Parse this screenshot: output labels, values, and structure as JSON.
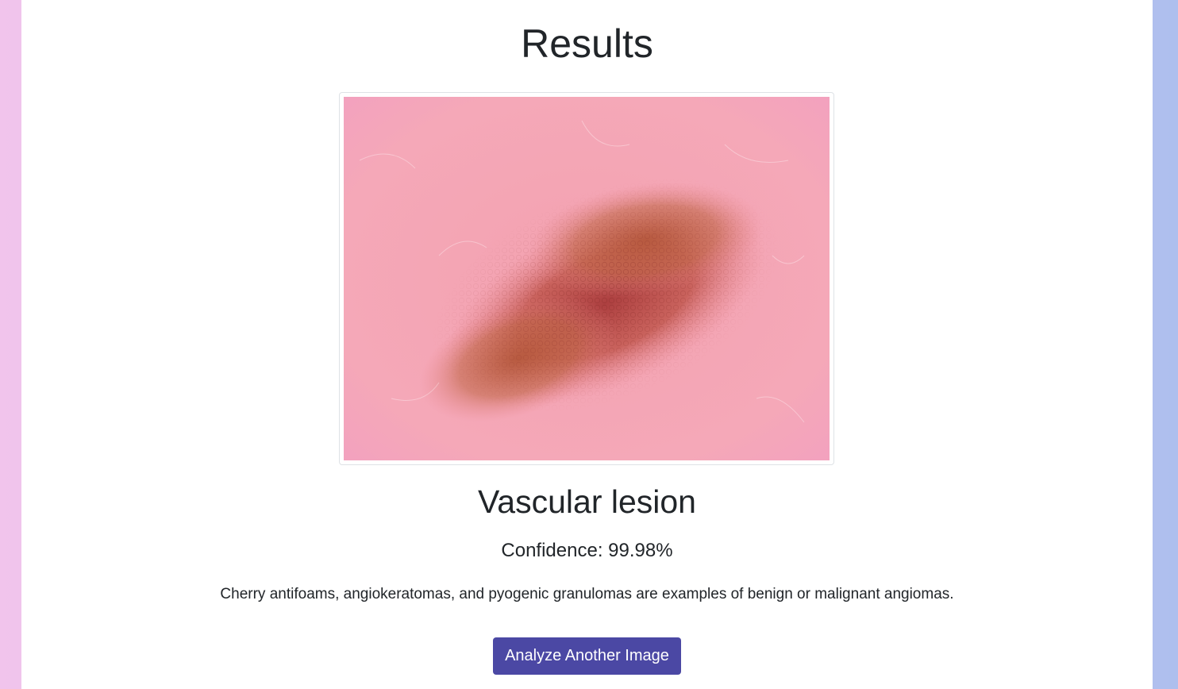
{
  "page": {
    "title": "Results"
  },
  "result": {
    "image_alt": "Uploaded skin lesion image",
    "diagnosis": "Vascular lesion",
    "confidence_label": "Confidence:",
    "confidence_value": "99.98%",
    "description": "Cherry antifoams, angiokeratomas, and pyogenic granulomas are examples of benign or malignant angiomas."
  },
  "actions": {
    "analyze_another_label": "Analyze Another Image"
  },
  "colors": {
    "background_left": "#f1c4ec",
    "background_right": "#aebfee",
    "button": "#4b48a4",
    "text": "#212529"
  }
}
